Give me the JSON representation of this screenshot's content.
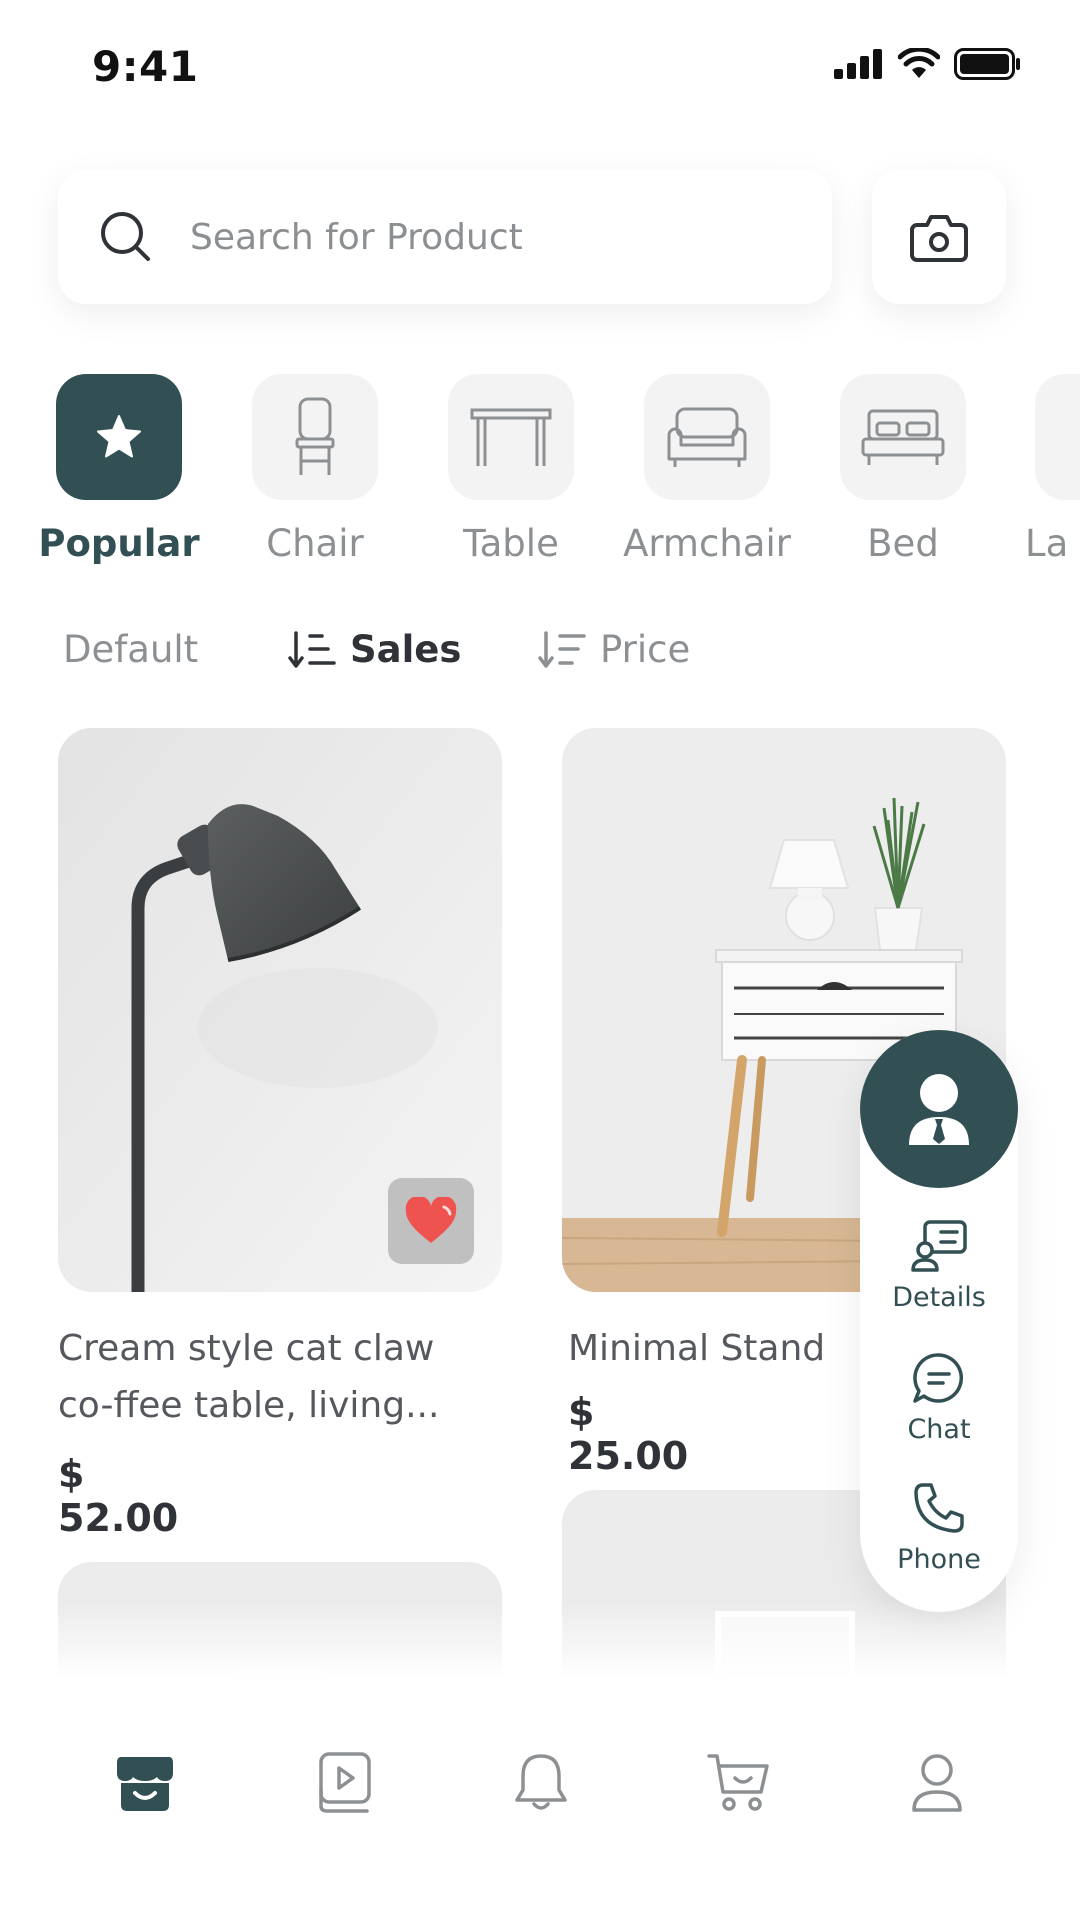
{
  "status_bar": {
    "time": "9:41"
  },
  "search": {
    "placeholder": "Search for Product"
  },
  "categories": [
    {
      "label": "Popular",
      "icon": "star-icon",
      "active": true
    },
    {
      "label": "Chair",
      "icon": "chair-icon",
      "active": false
    },
    {
      "label": "Table",
      "icon": "table-icon",
      "active": false
    },
    {
      "label": "Armchair",
      "icon": "armchair-icon",
      "active": false
    },
    {
      "label": "Bed",
      "icon": "bed-icon",
      "active": false
    },
    {
      "label": "La",
      "icon": "lamp-icon",
      "active": false
    }
  ],
  "sort": {
    "default_label": "Default",
    "sales_label": "Sales",
    "price_label": "Price",
    "active": "Sales"
  },
  "products": [
    {
      "name_line1": "Cream style cat claw",
      "name_line2": "co-ffee table, living...",
      "price": "$ 52.00",
      "favorited": true,
      "image": "floor-lamp-photo"
    },
    {
      "name_line1": "Minimal Stand",
      "price": "$ 25.00",
      "image": "side-table-photo"
    }
  ],
  "contact_panel": {
    "details_label": "Details",
    "chat_label": "Chat",
    "phone_label": "Phone"
  },
  "bottom_nav": [
    "store-icon",
    "video-icon",
    "bell-icon",
    "cart-icon",
    "profile-icon"
  ],
  "colors": {
    "accent": "#325054",
    "heart": "#ef5350",
    "muted_text": "#8d9093"
  }
}
